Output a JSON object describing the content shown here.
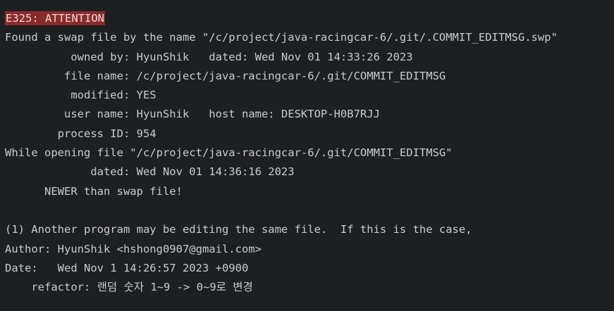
{
  "terminal": {
    "lines": [
      "",
      "Found a swap file by the name \"/c/project/java-racingcar-6/.git/.COMMIT_EDITMSG.swp\"",
      "          owned by: HyunShik   dated: Wed Nov 01 14:33:26 2023",
      "         file name: /c/project/java-racingcar-6/.git/COMMIT_EDITMSG",
      "          modified: YES",
      "         user name: HyunShik   host name: DESKTOP-H0B7RJJ",
      "        process ID: 954",
      "While opening file \"/c/project/java-racingcar-6/.git/COMMIT_EDITMSG\"",
      "             dated: Wed Nov 01 14:36:16 2023",
      "      NEWER than swap file!",
      "",
      "(1) Another program may be editing the same file.  If this is the case,",
      "Author: HyunShik <hshong0907@gmail.com>",
      "Date:   Wed Nov 1 14:26:57 2023 +0900",
      "    refactor: 랜덤 숫자 1~9 -> 0~9로 변경"
    ],
    "error_label": "E325: ATTENTION",
    "colors": {
      "background": "#1e1f22",
      "foreground": "#c9cbd1",
      "error_highlight": "#8a2b2b"
    }
  }
}
